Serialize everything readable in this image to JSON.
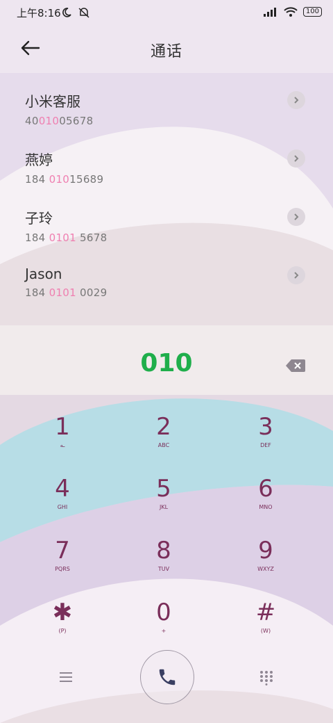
{
  "status": {
    "time": "上午8:16",
    "battery": "100"
  },
  "header": {
    "title": "通话"
  },
  "contacts": [
    {
      "name": "小米客服",
      "num_pre": "40",
      "num_hl": "010",
      "num_post": "05678"
    },
    {
      "name": "燕婷",
      "num_pre": "184 ",
      "num_hl": "010",
      "num_post": "15689"
    },
    {
      "name": "子玲",
      "num_pre": "184 ",
      "num_hl": "0101",
      "num_post": " 5678"
    },
    {
      "name": "Jason",
      "num_pre": "184 ",
      "num_hl": "0101",
      "num_post": " 0029"
    }
  ],
  "dialer": {
    "input": "010",
    "keys": [
      {
        "digit": "1",
        "letters": "ـه"
      },
      {
        "digit": "2",
        "letters": "ABC"
      },
      {
        "digit": "3",
        "letters": "DEF"
      },
      {
        "digit": "4",
        "letters": "GHI"
      },
      {
        "digit": "5",
        "letters": "JKL"
      },
      {
        "digit": "6",
        "letters": "MNO"
      },
      {
        "digit": "7",
        "letters": "PQRS"
      },
      {
        "digit": "8",
        "letters": "TUV"
      },
      {
        "digit": "9",
        "letters": "WXYZ"
      },
      {
        "digit": "✱",
        "letters": "(P)"
      },
      {
        "digit": "0",
        "letters": "+"
      },
      {
        "digit": "#",
        "letters": "(W)"
      }
    ]
  },
  "colors": {
    "accent_green": "#1fae4b",
    "highlight_pink": "#ef7fb0",
    "key_text": "#7a2e5a",
    "wave_blue": "#b7dde6"
  }
}
